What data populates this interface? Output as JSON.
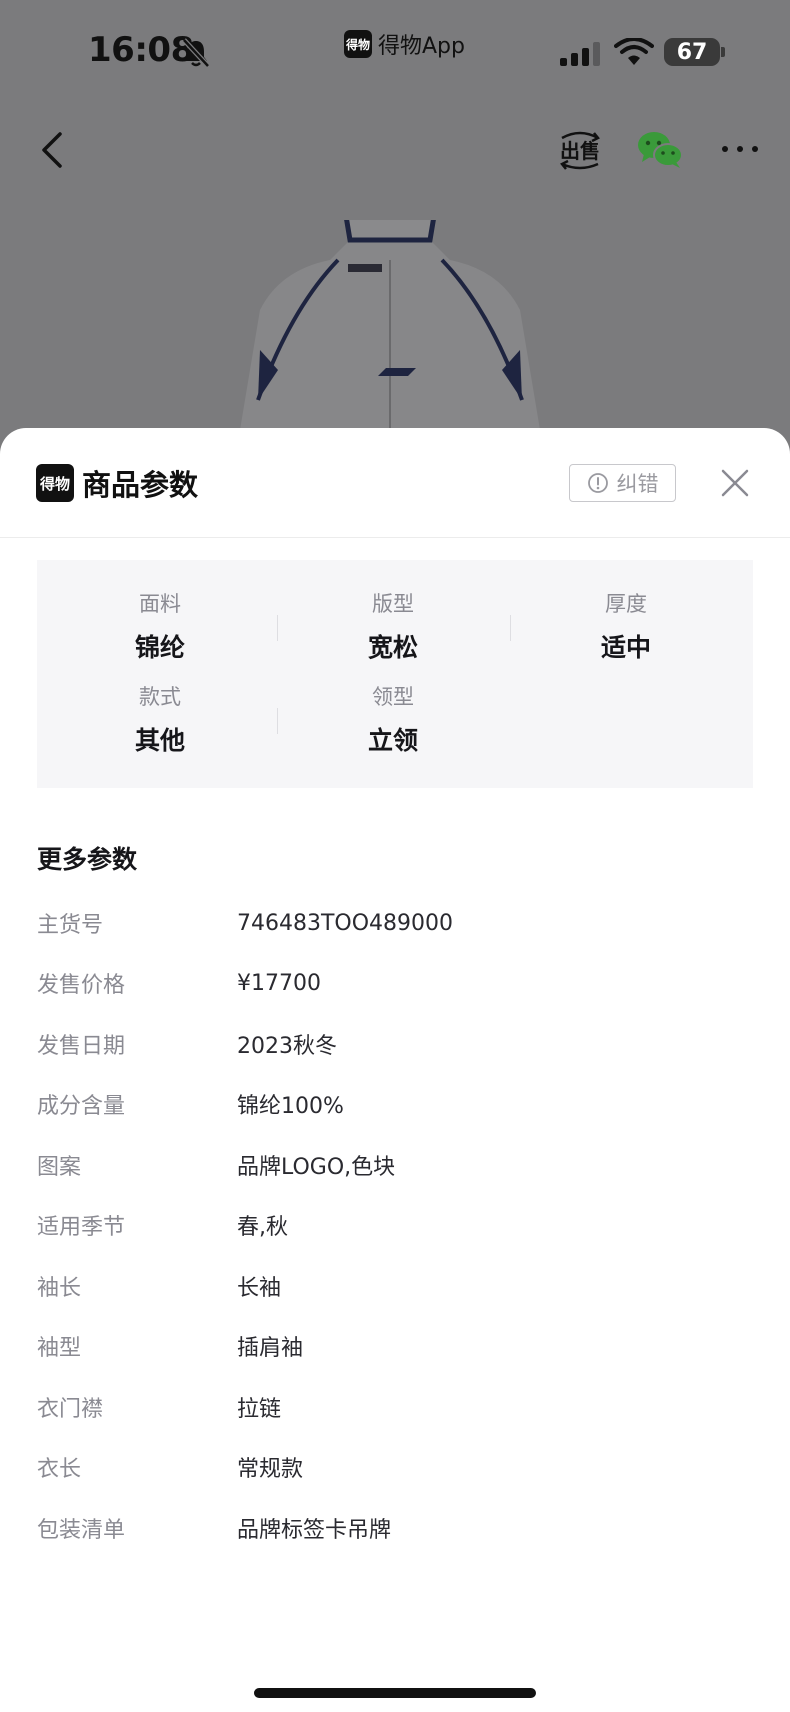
{
  "status_bar": {
    "time": "16:08",
    "app_name": "得物App",
    "app_logo": "得物",
    "battery": "67"
  },
  "nav": {
    "sell_label": "出售"
  },
  "sheet": {
    "logo": "得物",
    "title": "商品参数",
    "report_label": "纠错"
  },
  "specs": [
    {
      "label": "面料",
      "value": "锦纶"
    },
    {
      "label": "版型",
      "value": "宽松"
    },
    {
      "label": "厚度",
      "value": "适中"
    },
    {
      "label": "款式",
      "value": "其他"
    },
    {
      "label": "领型",
      "value": "立领"
    }
  ],
  "more_params": {
    "title": "更多参数",
    "rows": [
      {
        "key": "主货号",
        "value": "746483TOO489000"
      },
      {
        "key": "发售价格",
        "value": "¥17700"
      },
      {
        "key": "发售日期",
        "value": "2023秋冬"
      },
      {
        "key": "成分含量",
        "value": "锦纶100%"
      },
      {
        "key": "图案",
        "value": "品牌LOGO,色块"
      },
      {
        "key": "适用季节",
        "value": "春,秋"
      },
      {
        "key": "袖长",
        "value": "长袖"
      },
      {
        "key": "袖型",
        "value": "插肩袖"
      },
      {
        "key": "衣门襟",
        "value": "拉链"
      },
      {
        "key": "衣长",
        "value": "常规款"
      },
      {
        "key": "包装清单",
        "value": "品牌标签卡吊牌"
      }
    ]
  },
  "colors": {
    "overlay": "#7b7b7d",
    "spec_bg": "#f6f6f8",
    "muted_text": "#8a8a92",
    "wechat_green": "#3a9a3a"
  }
}
